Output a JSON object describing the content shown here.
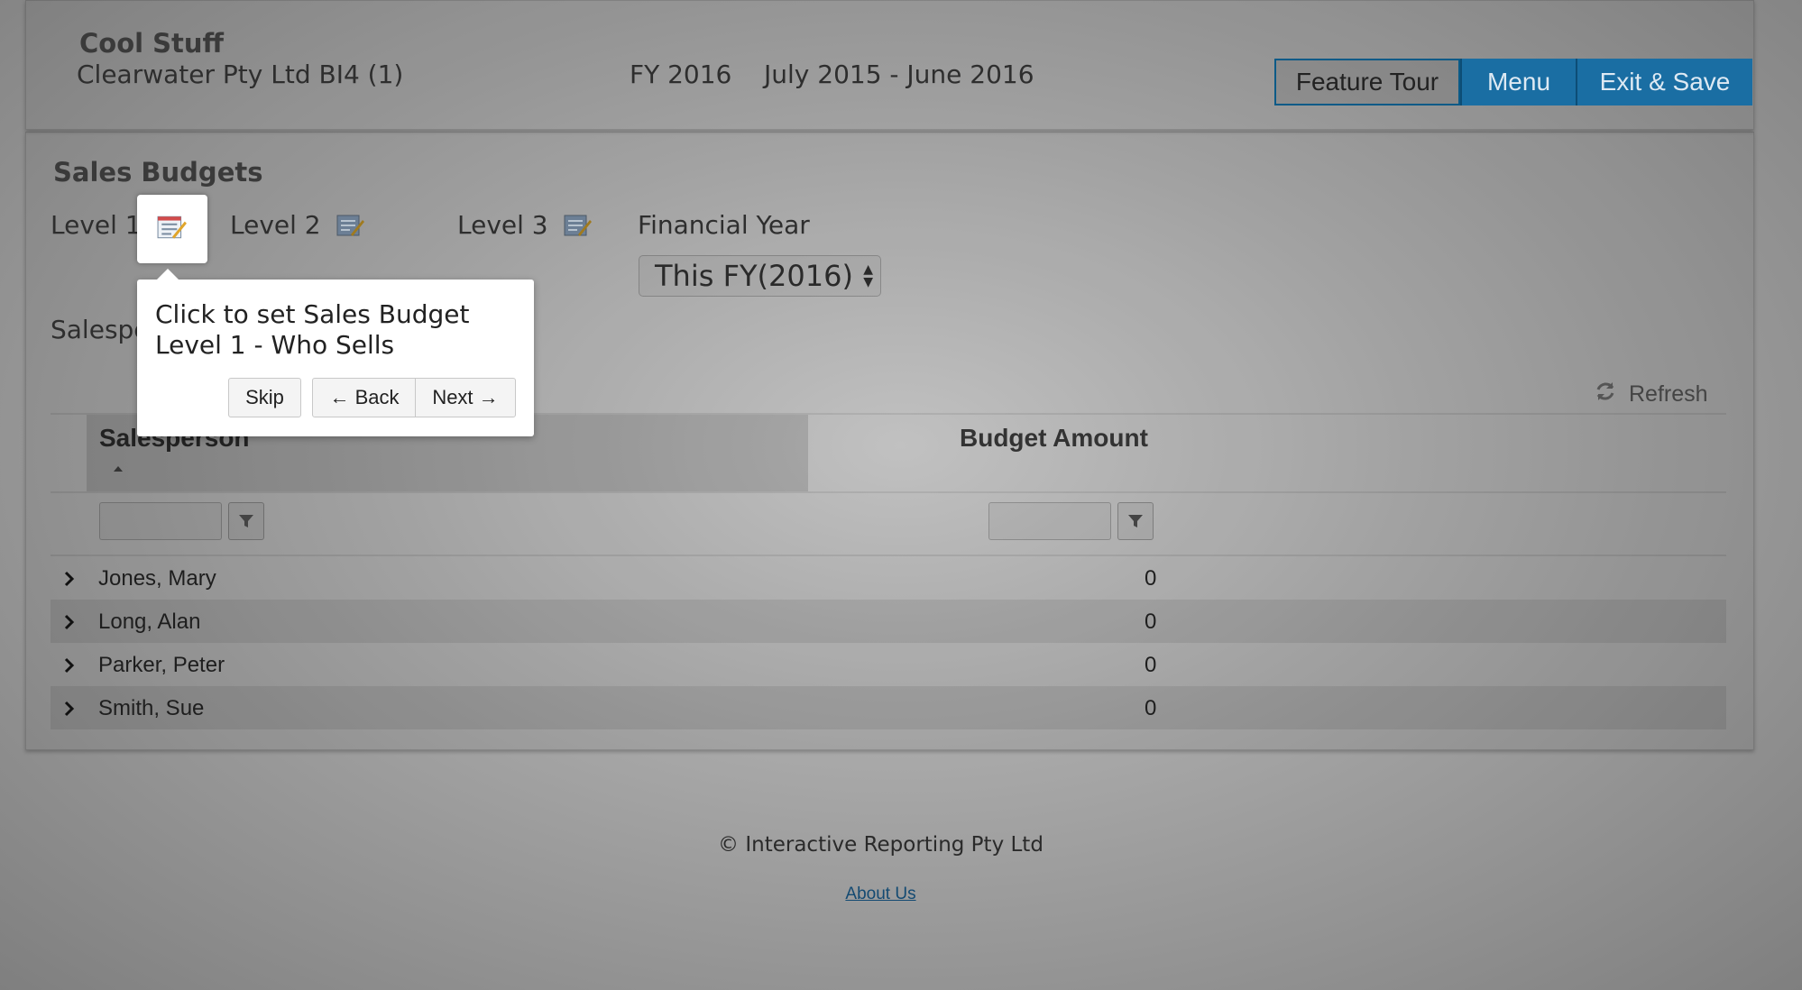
{
  "header": {
    "company": "Cool Stuff",
    "client": "Clearwater Pty Ltd BI4 (1)",
    "fy": "FY 2016",
    "period": "July 2015 - June 2016",
    "buttons": {
      "feature_tour": "Feature Tour",
      "menu": "Menu",
      "exit_save": "Exit & Save"
    }
  },
  "section": {
    "title": "Sales Budgets",
    "levels": [
      {
        "label": "Level 1",
        "icon": "edit-budget-icon"
      },
      {
        "label": "Level 2",
        "icon": "edit-budget-icon"
      },
      {
        "label": "Level 3",
        "icon": "edit-budget-icon"
      }
    ],
    "financial_year_label": "Financial Year",
    "financial_year_value": "This FY(2016)",
    "salesperson_label": "Salespe"
  },
  "toolbar": {
    "refresh_label": "Refresh",
    "refresh_icon": "refresh-icon"
  },
  "grid": {
    "columns": [
      "Salesperson",
      "Budget Amount"
    ],
    "rows": [
      {
        "name": "Jones, Mary",
        "amount": "0"
      },
      {
        "name": "Long, Alan",
        "amount": "0"
      },
      {
        "name": "Parker, Peter",
        "amount": "0"
      },
      {
        "name": "Smith, Sue",
        "amount": "0"
      }
    ]
  },
  "tour": {
    "text": "Click to set Sales Budget Level 1 - Who Sells",
    "skip": "Skip",
    "back": "← Back",
    "next": "Next →"
  },
  "footer": {
    "copyright": "© Interactive Reporting Pty Ltd",
    "about": "About Us"
  },
  "colors": {
    "accent": "#1a6ea3",
    "accent_text": "#dde9f3"
  }
}
